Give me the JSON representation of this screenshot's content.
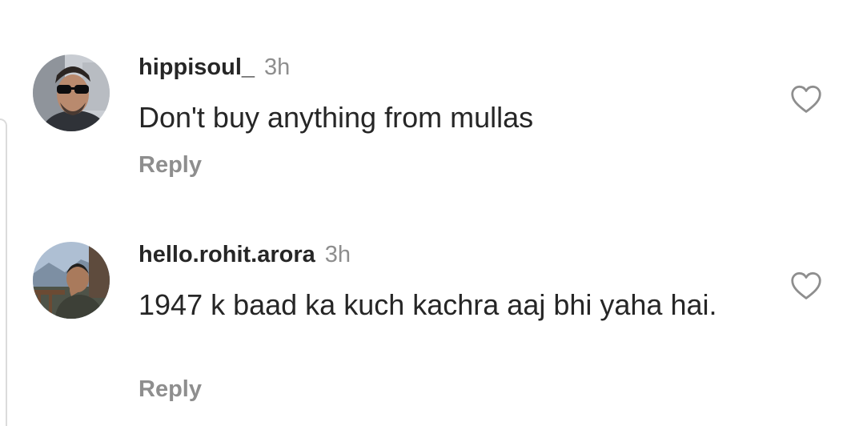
{
  "comments": [
    {
      "username": "hippisoul_",
      "time": "3h",
      "text": "Don't buy anything from mullas",
      "reply_label": "Reply",
      "like_icon": "heart-outline-icon"
    },
    {
      "username": "hello.rohit.arora",
      "time": "3h",
      "text": "1947 k baad ka kuch kachra aaj bhi yaha hai.",
      "reply_label": "Reply",
      "like_icon": "heart-outline-icon"
    }
  ],
  "colors": {
    "text": "#262626",
    "secondary": "#8e8e8e",
    "background": "#ffffff"
  }
}
